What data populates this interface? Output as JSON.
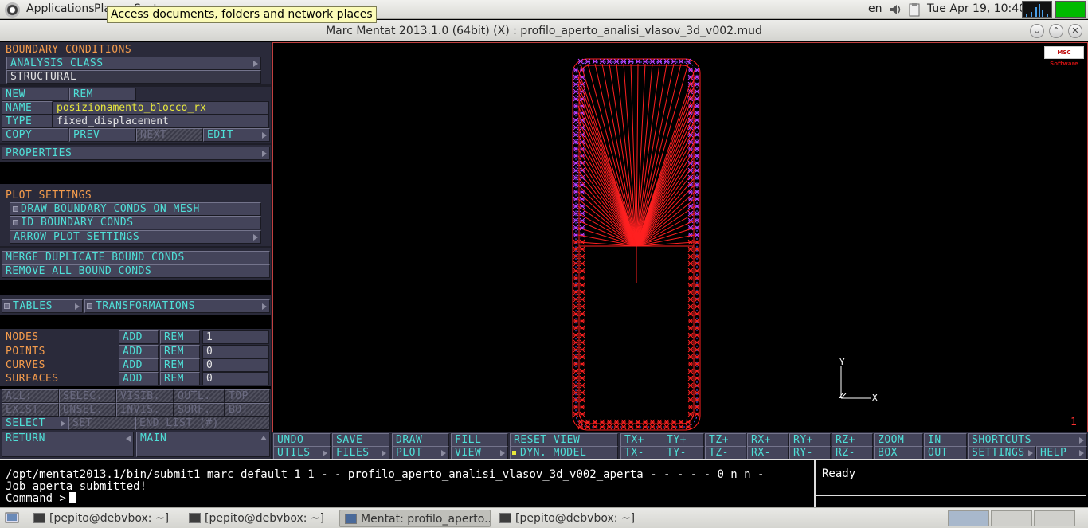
{
  "top_panel": {
    "applications": "Applications",
    "places": "Places",
    "system": "System",
    "tooltip": "Access documents, folders and network places",
    "keyboard_layout": "en",
    "clock": "Tue Apr 19, 10:40"
  },
  "window": {
    "title": "Marc Mentat 2013.1.0 (64bit) (X) : profilo_aperto_analisi_vlasov_3d_v002.mud"
  },
  "left_panel": {
    "boundary_conditions": "BOUNDARY CONDITIONS",
    "analysis_class": "ANALYSIS CLASS",
    "analysis_class_value": "STRUCTURAL",
    "new": "NEW",
    "rem": "REM",
    "name_label": "NAME",
    "name_value": "posizionamento_blocco_rx",
    "type_label": "TYPE",
    "type_value": "fixed_displacement",
    "copy": "COPY",
    "prev": "PREV",
    "next": "NEXT",
    "edit": "EDIT",
    "properties": "PROPERTIES",
    "plot_settings": "PLOT SETTINGS",
    "draw_bc_on_mesh": "DRAW BOUNDARY CONDS ON MESH",
    "id_bc": "ID BOUNDARY CONDS",
    "arrow_plot_settings": "ARROW PLOT SETTINGS",
    "merge_duplicate": "MERGE DUPLICATE BOUND CONDS",
    "remove_all": "REMOVE ALL BOUND CONDS",
    "tables": "TABLES",
    "transformations": "TRANSFORMATIONS",
    "entities": [
      {
        "label": "NODES",
        "add": "ADD",
        "rem": "REM",
        "count": "1"
      },
      {
        "label": "POINTS",
        "add": "ADD",
        "rem": "REM",
        "count": "0"
      },
      {
        "label": "CURVES",
        "add": "ADD",
        "rem": "REM",
        "count": "0"
      },
      {
        "label": "SURFACES",
        "add": "ADD",
        "rem": "REM",
        "count": "0"
      }
    ],
    "select_row1": [
      "ALL:",
      "SELEC.",
      "VISIB.",
      "OUTL.",
      "TOP"
    ],
    "select_row2": [
      "EXIST.",
      "UNSEL.",
      "INVIS.",
      "SURF.",
      "BOT."
    ],
    "select": "SELECT",
    "set": "SET",
    "end_list": "END LIST (#)",
    "return": "RETURN",
    "main": "MAIN"
  },
  "viewport": {
    "logo": "MSC Software",
    "view_number": "1",
    "axis_x": "X",
    "axis_y": "Y",
    "axis_z": "Z"
  },
  "static_menu": {
    "undo": "UNDO",
    "utils": "UTILS",
    "save": "SAVE",
    "files": "FILES",
    "draw": "DRAW",
    "plot": "PLOT",
    "fill": "FILL",
    "view": "VIEW",
    "reset_view": "RESET VIEW",
    "dyn_model": "DYN. MODEL",
    "tx_plus": "TX+",
    "tx_minus": "TX-",
    "ty_plus": "TY+",
    "ty_minus": "TY-",
    "tz_plus": "TZ+",
    "tz_minus": "TZ-",
    "rx_plus": "RX+",
    "rx_minus": "RX-",
    "ry_plus": "RY+",
    "ry_minus": "RY-",
    "rz_plus": "RZ+",
    "rz_minus": "RZ-",
    "zoom": "ZOOM",
    "box": "BOX",
    "in": "IN",
    "out": "OUT",
    "shortcuts": "SHORTCUTS",
    "settings": "SETTINGS",
    "help": "HELP"
  },
  "command": {
    "line1": "/opt/mentat2013.1/bin/submit1 marc default 1 1 - - profilo_aperto_analisi_vlasov_3d_v002_aperta - - - - - 0 n n -",
    "line2": "Job aperta submitted!",
    "prompt": "Command >"
  },
  "status": {
    "text": "Ready"
  },
  "taskbar": {
    "tasks": [
      "[pepito@debvbox: ~]",
      "[pepito@debvbox: ~]",
      "Mentat: profilo_aperto...",
      "[pepito@debvbox: ~]"
    ]
  },
  "colors": {
    "accent_orange": "#f59c4c",
    "accent_cyan": "#4fe0d8",
    "mesh_red": "#ff2020",
    "node_magenta": "#c040ff"
  }
}
